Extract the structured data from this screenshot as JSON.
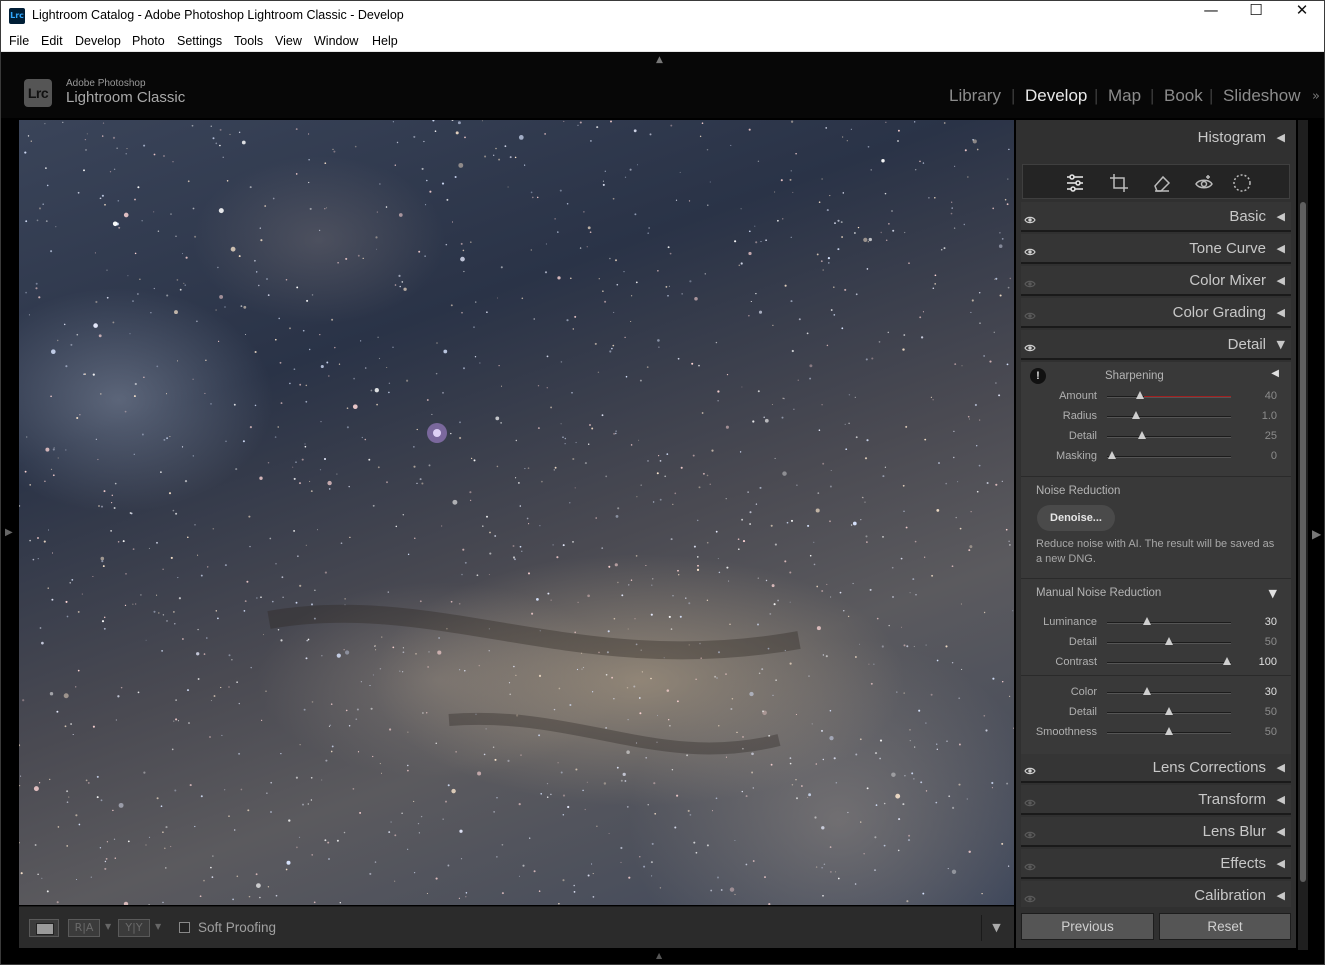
{
  "window": {
    "title": "Lightroom Catalog - Adobe Photoshop Lightroom Classic - Develop",
    "app_icon": "Lrc",
    "controls": [
      "minimize",
      "maximize",
      "close"
    ]
  },
  "menu": [
    "File",
    "Edit",
    "Develop",
    "Photo",
    "Settings",
    "Tools",
    "View",
    "Window",
    "Help"
  ],
  "brand": {
    "badge": "Lrc",
    "small": "Adobe Photoshop",
    "big": "Lightroom Classic"
  },
  "modules": {
    "items": [
      "Library",
      "Develop",
      "Map",
      "Book",
      "Slideshow"
    ],
    "active": "Develop",
    "more_icon": "double-chevron-right-icon"
  },
  "toolbar": {
    "loupe_icon": "loupe-view-icon",
    "before_after_label": "R|A",
    "before_after_yy_label": "Y|Y",
    "soft_proofing_label": "Soft Proofing",
    "soft_proofing_checked": false
  },
  "panels": {
    "histogram": "Histogram",
    "tools": [
      "edit-sliders-icon",
      "crop-icon",
      "eraser-icon",
      "red-eye-icon",
      "masking-icon"
    ],
    "sections": [
      {
        "label": "Basic",
        "collapsed": true
      },
      {
        "label": "Tone Curve",
        "collapsed": true
      },
      {
        "label": "Color Mixer",
        "collapsed": true
      },
      {
        "label": "Color Grading",
        "collapsed": true
      },
      {
        "label": "Detail",
        "collapsed": false
      },
      {
        "label": "Lens Corrections",
        "collapsed": true
      },
      {
        "label": "Transform",
        "collapsed": true
      },
      {
        "label": "Lens Blur",
        "collapsed": true
      },
      {
        "label": "Effects",
        "collapsed": true
      },
      {
        "label": "Calibration",
        "collapsed": true
      }
    ]
  },
  "detail": {
    "sharpening": {
      "title": "Sharpening",
      "sliders": [
        {
          "label": "Amount",
          "value": "40",
          "frac": 0.27
        },
        {
          "label": "Radius",
          "value": "1.0",
          "frac": 0.23
        },
        {
          "label": "Detail",
          "value": "25",
          "frac": 0.28
        },
        {
          "label": "Masking",
          "value": "0",
          "frac": 0.04
        }
      ]
    },
    "noise_reduction": {
      "title": "Noise Reduction",
      "denoise_label": "Denoise...",
      "description": "Reduce noise with AI. The result will be saved as a new DNG."
    },
    "manual_noise": {
      "title": "Manual Noise Reduction",
      "luminance_group": [
        {
          "label": "Luminance",
          "value": "30",
          "frac": 0.32
        },
        {
          "label": "Detail",
          "value": "50",
          "frac": 0.5
        },
        {
          "label": "Contrast",
          "value": "100",
          "frac": 0.97
        }
      ],
      "color_group": [
        {
          "label": "Color",
          "value": "30",
          "frac": 0.32
        },
        {
          "label": "Detail",
          "value": "50",
          "frac": 0.5
        },
        {
          "label": "Smoothness",
          "value": "50",
          "frac": 0.5
        }
      ]
    }
  },
  "buttons": {
    "previous": "Previous",
    "reset": "Reset"
  },
  "colors": {
    "panel_bg": "#303030",
    "accent_red": "#a02020"
  }
}
